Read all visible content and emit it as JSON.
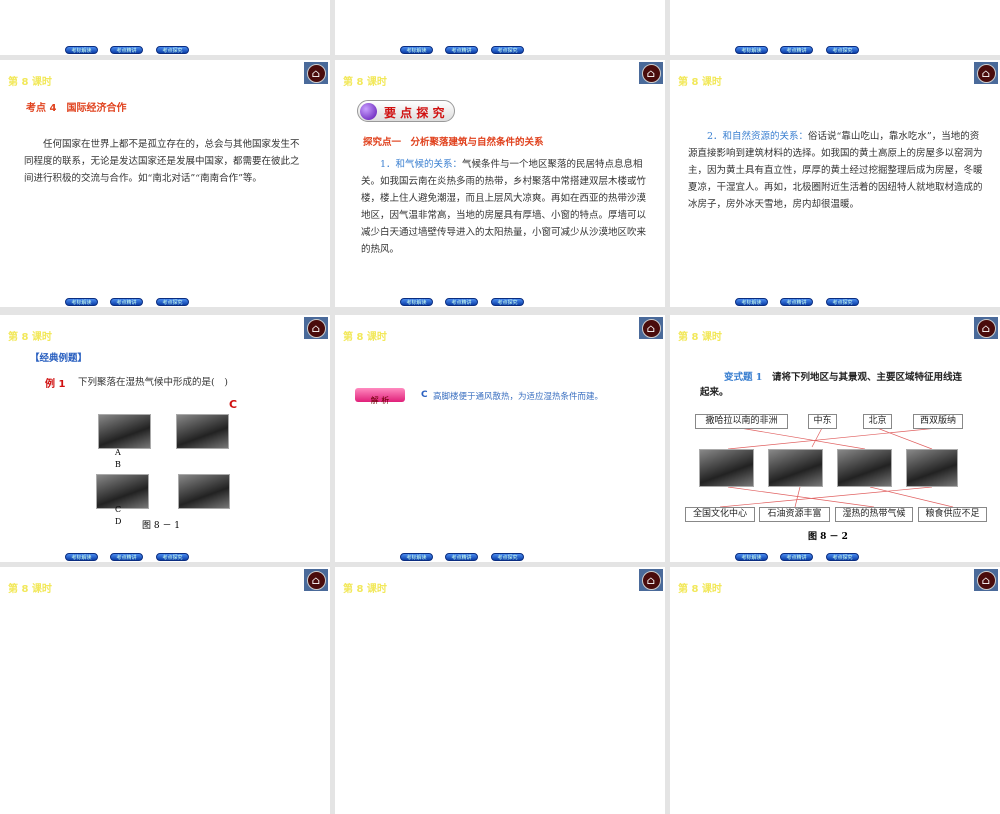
{
  "common": {
    "lesson": "第 8 课时",
    "buttons": [
      "考标解读",
      "考点精讲",
      "考点探究"
    ]
  },
  "s4": {
    "heading": "考点 4　国际经济合作",
    "body": "任何国家在世界上都不是孤立存在的，总会与其他国家发生不同程度的联系，无论是发达国家还是发展中国家，都需要在彼此之间进行积极的交流与合作。如“南北对话”“南南合作”等。"
  },
  "s5": {
    "badge": "要 点 探 究",
    "heading": "探究点一　分析聚落建筑与自然条件的关系",
    "lead": "1．和气候的关系：",
    "body": "气候条件与一个地区聚落的民居特点息息相关。如我国云南在炎热多雨的热带，乡村聚落中常搭建双层木楼或竹楼，楼上住人避免潮湿，而且上层风大凉爽。再如在西亚的热带沙漠地区，因气温非常高，当地的房屋具有厚墙、小窗的特点。厚墙可以减少白天通过墙壁传导进入的太阳热量，小窗可减少从沙漠地区吹来的热风。"
  },
  "s6": {
    "lead": "2．和自然资源的关系：",
    "body": "俗话说“靠山吃山，靠水吃水”，当地的资源直接影响到建筑材料的选择。如我国的黄土高原上的房屋多以窑洞为主，因为黄土具有直立性，厚厚的黄土经过挖掘整理后成为房屋，冬暖夏凉，干湿宜人。再如，北极圈附近生活着的因纽特人就地取材造成的冰房子，房外冰天雪地，房内却很温暖。"
  },
  "s7": {
    "section": "【经典例题】",
    "label": "例 1",
    "question": "下列聚落在湿热气候中形成的是(　)",
    "answer": "C",
    "opts": [
      "A",
      "B",
      "C",
      "D"
    ],
    "caption": "图 8 － 1"
  },
  "s8": {
    "badge": "解 析",
    "answer": "C",
    "body": "高脚楼便于通风散热，为适应湿热条件而建。"
  },
  "s9": {
    "label": "变式题 1",
    "question": "请将下列地区与其景观、主要区域特征用线连起来。",
    "regions": [
      "撒哈拉以南的非洲",
      "中东",
      "北京",
      "西双版纳"
    ],
    "features": [
      "全国文化中心",
      "石油资源丰富",
      "湿热的热带气候",
      "粮食供应不足"
    ],
    "caption": "图 8 － 2"
  }
}
